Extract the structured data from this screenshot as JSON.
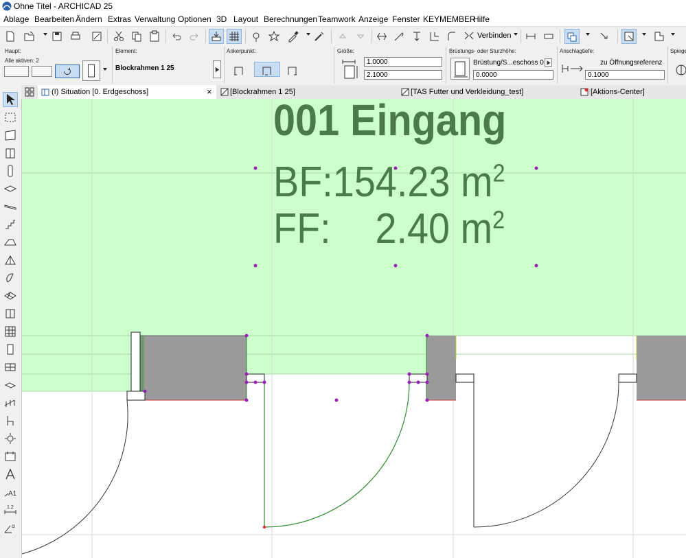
{
  "window": {
    "title": "Ohne Titel - ARCHICAD 25"
  },
  "menu": [
    "Ablage",
    "Bearbeiten",
    "Ändern",
    "Extras",
    "Verwaltung",
    "Optionen",
    "3D",
    "Layout",
    "Berechnungen",
    "Teamwork",
    "Anzeige",
    "Fenster",
    "KEYMEMBER",
    "Hilfe"
  ],
  "toolbar": {
    "connect_label": "Verbinden"
  },
  "infobox": {
    "main_label": "Haupt:",
    "all_active_label": "Alle aktiven: 2",
    "element_label": "Element:",
    "element_value": "Blockrahmen 1 25",
    "anchor_label": "Ankerpunkt:",
    "size_label": "Größe:",
    "size_width": "1.0000",
    "size_height": "2.1000",
    "sill_label": "Brüstungs- oder Sturzhöhe:",
    "sill_ref": "Brüstung/S...eschoss 0",
    "sill_value": "0.0000",
    "reveal_label": "Anschlagtiefe:",
    "reveal_ref": "zu Öffnungsreferenz",
    "reveal_value": "0.1000",
    "mirror_label": "Spiege"
  },
  "tabs": [
    {
      "label": "(I) Situation [0. Erdgeschoss]",
      "close": "×"
    },
    {
      "label": "[Blockrahmen 1 25]"
    },
    {
      "label": "[TAS Futter und Verkleidung_test]"
    },
    {
      "label": "[Aktions-Center]"
    }
  ],
  "zone": {
    "name": "001 Eingang",
    "bf_label": "BF:",
    "bf_value": "154.23 m",
    "ff_label": "FF:",
    "ff_value": "2.40 m",
    "sup": "2"
  },
  "colors": {
    "zone_fill": "#ccffcc",
    "zone_text": "#4a7a4a",
    "wall_fill": "#9a9a9a",
    "selection": "#9a1fb8",
    "door_swing": "#2a8a2a"
  },
  "toolbox_icons": [
    "arrow-icon",
    "marquee-icon",
    "zone-icon",
    "door-icon",
    "column-icon",
    "slab-icon",
    "beam-icon",
    "stair-icon",
    "roof-icon",
    "shell-icon",
    "mesh-icon",
    "curtain-wall-icon",
    "window-grid-icon",
    "door-tool-icon",
    "skylight-icon",
    "railing-icon",
    "object-icon",
    "chair-icon",
    "lamp-icon",
    "label-icon",
    "text-icon",
    "dimension-icon",
    "level-icon",
    "angle-icon"
  ]
}
